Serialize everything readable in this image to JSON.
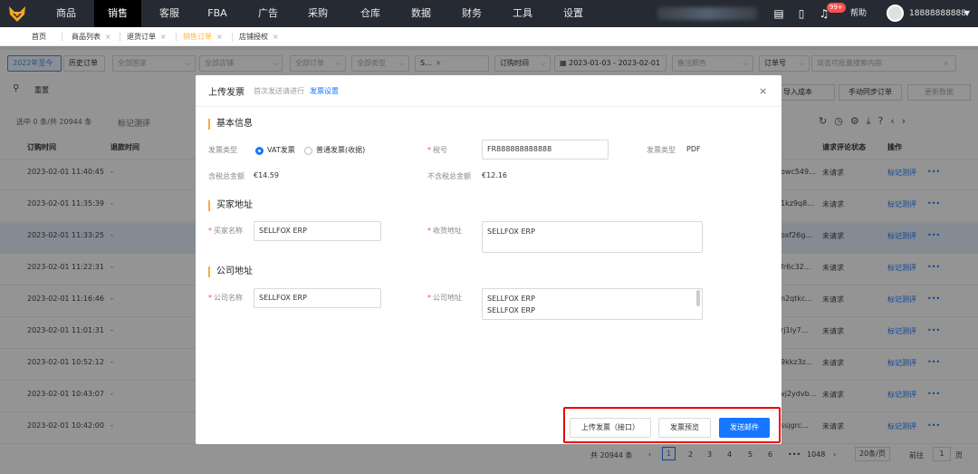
{
  "nav": {
    "items": [
      "商品",
      "销售",
      "客服",
      "FBA",
      "广告",
      "采购",
      "仓库",
      "数据",
      "财务",
      "工具",
      "设置"
    ],
    "help": "帮助",
    "username": "18888888888",
    "badge": "99+"
  },
  "tabs": [
    {
      "label": "首页",
      "closable": false
    },
    {
      "label": "商品列表",
      "closable": true
    },
    {
      "label": "退货订单",
      "closable": true
    },
    {
      "label": "销售订单",
      "closable": true
    },
    {
      "label": "店铺授权",
      "closable": true
    }
  ],
  "filters": {
    "date_preset": "2022年至今",
    "history": "历史订单",
    "country": "全部国家",
    "store": "全部店铺",
    "order_type": "全部订单",
    "type": "全部类型",
    "s_tag": "S...",
    "time_field": "订购时间",
    "date_range": "2023-01-03  -  2023-02-01",
    "remark_color": "备注颜色",
    "order_no_field": "订单号",
    "search_placeholder": "双击可批量搜索内容"
  },
  "toolbar": {
    "reset": "重置",
    "import_cost": "导入成本",
    "manual_sync": "手动同步订单",
    "update_data": "更新数据",
    "selected_summary": "选中 0 条/共 20944 条",
    "mark_review": "标记测评"
  },
  "table": {
    "headers": {
      "order_time": "订购时间",
      "return_time": "退款时间",
      "review_status": "请求评论状态",
      "actions": "操作"
    },
    "rows": [
      {
        "time": "2023-02-01 11:40:45",
        "refund": "-",
        "id": "owc549...",
        "status": "未请求",
        "action": "标记测评"
      },
      {
        "time": "2023-02-01 11:35:39",
        "refund": "-",
        "id": "1kz9q8...",
        "status": "未请求",
        "action": "标记测评"
      },
      {
        "time": "2023-02-01 11:33:25",
        "refund": "-",
        "id": "oxf26g...",
        "status": "未请求",
        "action": "标记测评"
      },
      {
        "time": "2023-02-01 11:22:31",
        "refund": "-",
        "id": "fr6c32...",
        "status": "未请求",
        "action": "标记测评"
      },
      {
        "time": "2023-02-01 11:16:46",
        "refund": "-",
        "id": "n2qtkc...",
        "status": "未请求",
        "action": "标记测评"
      },
      {
        "time": "2023-02-01 11:01:31",
        "refund": "-",
        "id": "rj1ly7...",
        "status": "未请求",
        "action": "标记测评"
      },
      {
        "time": "2023-02-01 10:52:12",
        "refund": "-",
        "id": "9kkz3z...",
        "status": "未请求",
        "action": "标记测评"
      },
      {
        "time": "2023-02-01 10:43:07",
        "refund": "-",
        "id": "vj2ydvb...",
        "status": "未请求",
        "action": "标记测评"
      },
      {
        "time": "2023-02-01 10:42:00",
        "refund": "-",
        "id": "ssjgrc...",
        "status": "未请求",
        "action": "标记测评"
      }
    ]
  },
  "pagination": {
    "total": "共 20944 条",
    "pages": [
      "1",
      "2",
      "3",
      "4",
      "5",
      "6"
    ],
    "ellipsis": "•••",
    "last": "1048",
    "page_size": "20条/页",
    "goto_label": "前往",
    "goto_value": "1",
    "page_suffix": "页"
  },
  "modal": {
    "title": "上传发票",
    "subtitle": "首次发送请进行",
    "settings_link": "发票设置",
    "basic_section": "基本信息",
    "invoice_type_label": "发票类型",
    "vat_option": "VAT发票",
    "normal_option": "普通发票(收据)",
    "tax_no_label": "税号",
    "tax_no_value": "FR888888888888",
    "format_label": "发票类型",
    "format_value": "PDF",
    "incl_tax_label": "含税总金额",
    "incl_tax_value": "€14.59",
    "excl_tax_label": "不含税总金额",
    "excl_tax_value": "€12.16",
    "buyer_section": "买家地址",
    "buyer_name_label": "买家名称",
    "buyer_name_value": "SELLFOX ERP",
    "ship_addr_label": "收货地址",
    "ship_addr_value": "SELLFOX ERP",
    "company_section": "公司地址",
    "company_name_label": "公司名称",
    "company_name_value": "SELLFOX ERP",
    "company_addr_label": "公司地址",
    "company_addr_line1": "SELLFOX ERP",
    "company_addr_line2": "SELLFOX ERP",
    "btn_upload": "上传发票（接口）",
    "btn_preview": "发票预览",
    "btn_send": "发送邮件"
  },
  "colors": {
    "accent": "#1677ff",
    "nav_bg": "#262b33",
    "highlight": "#e00000",
    "section_bar": "#ffa940"
  }
}
